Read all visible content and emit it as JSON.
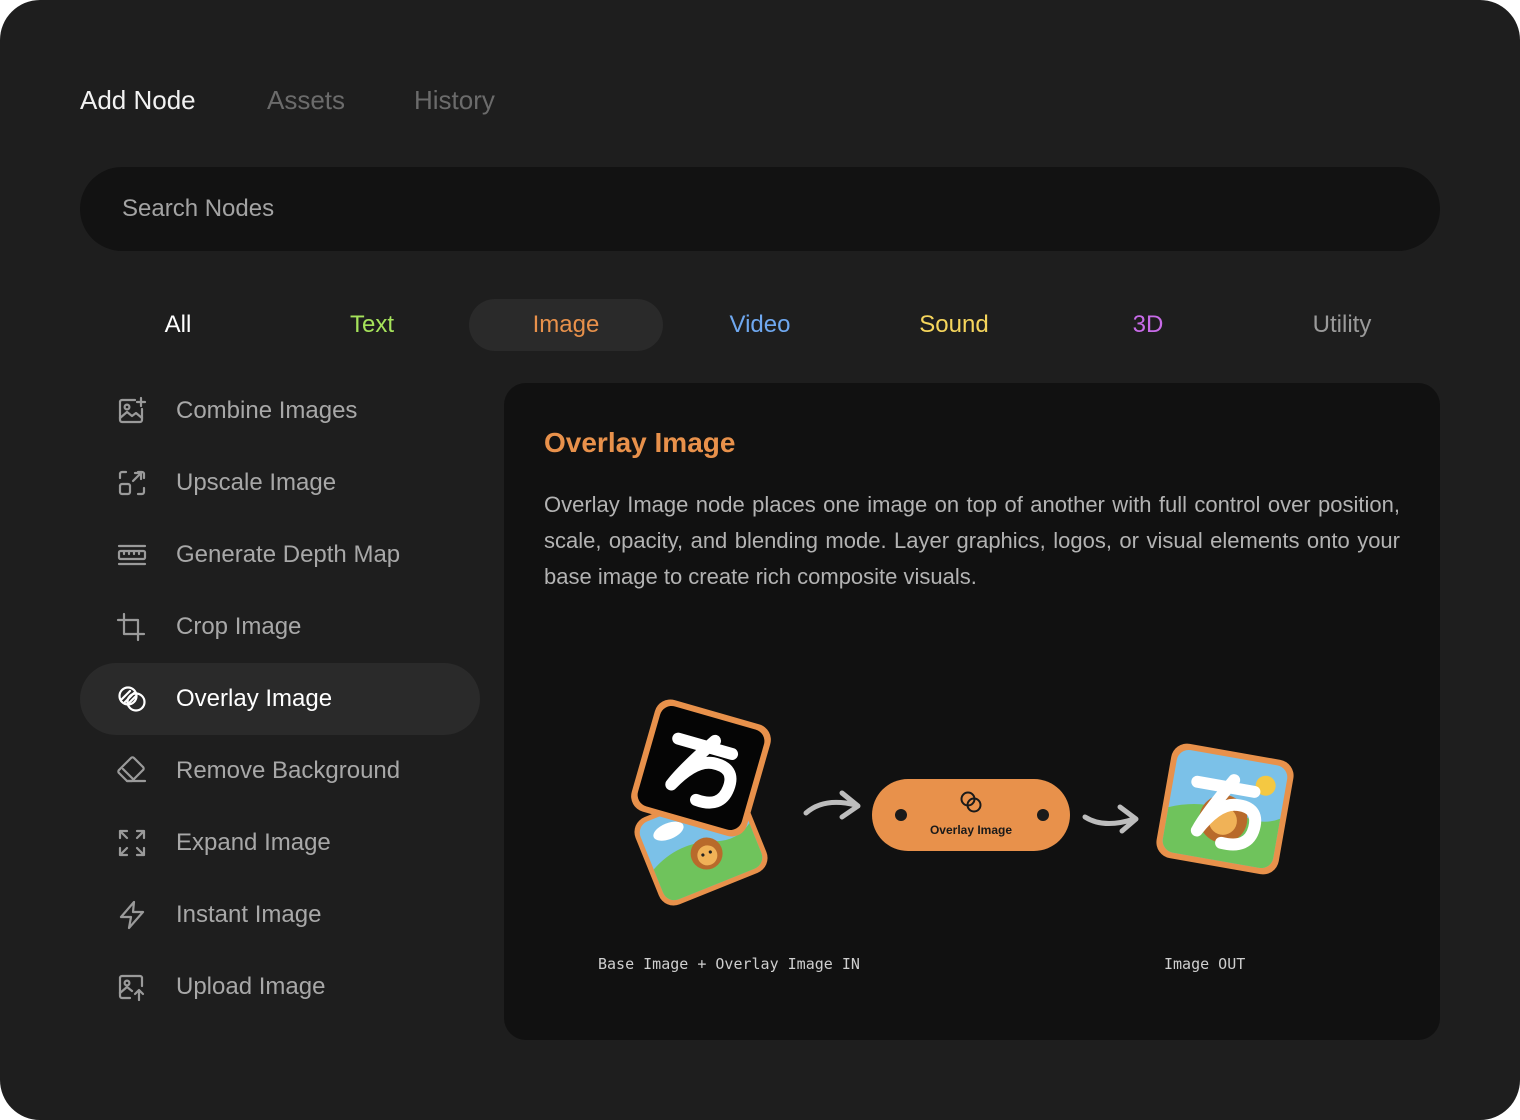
{
  "tabs": {
    "add_node": "Add Node",
    "assets": "Assets",
    "history": "History"
  },
  "search": {
    "placeholder": "Search Nodes"
  },
  "categories": [
    {
      "label": "All",
      "color": "#ffffff"
    },
    {
      "label": "Text",
      "color": "#a6e35b"
    },
    {
      "label": "Image",
      "color": "#e8914b"
    },
    {
      "label": "Video",
      "color": "#6fa8f0"
    },
    {
      "label": "Sound",
      "color": "#f5d55c"
    },
    {
      "label": "3D",
      "color": "#c86be8"
    },
    {
      "label": "Utility",
      "color": "#9a9a9a"
    }
  ],
  "selected_category": "Image",
  "nodes": [
    {
      "label": "Combine Images",
      "icon": "image-plus-icon"
    },
    {
      "label": "Upscale Image",
      "icon": "upscale-icon"
    },
    {
      "label": "Generate Depth Map",
      "icon": "depth-map-icon"
    },
    {
      "label": "Crop Image",
      "icon": "crop-icon"
    },
    {
      "label": "Overlay Image",
      "icon": "overlay-icon"
    },
    {
      "label": "Remove Background",
      "icon": "eraser-icon"
    },
    {
      "label": "Expand Image",
      "icon": "expand-icon"
    },
    {
      "label": "Instant Image",
      "icon": "lightning-icon"
    },
    {
      "label": "Upload Image",
      "icon": "image-upload-icon"
    }
  ],
  "selected_node": "Overlay Image",
  "detail": {
    "title": "Overlay Image",
    "description": "Overlay Image node places one image on top of another with full control over position, scale, opacity, and blending mode. Layer graphics, logos, or visual elements onto your base image to create rich composite visuals.",
    "node_chip_label": "Overlay Image",
    "input_caption": "Base Image + Overlay Image IN",
    "output_caption": "Image OUT"
  },
  "colors": {
    "accent": "#e8914b",
    "panel": "#1e1e1e",
    "card": "#111111"
  }
}
